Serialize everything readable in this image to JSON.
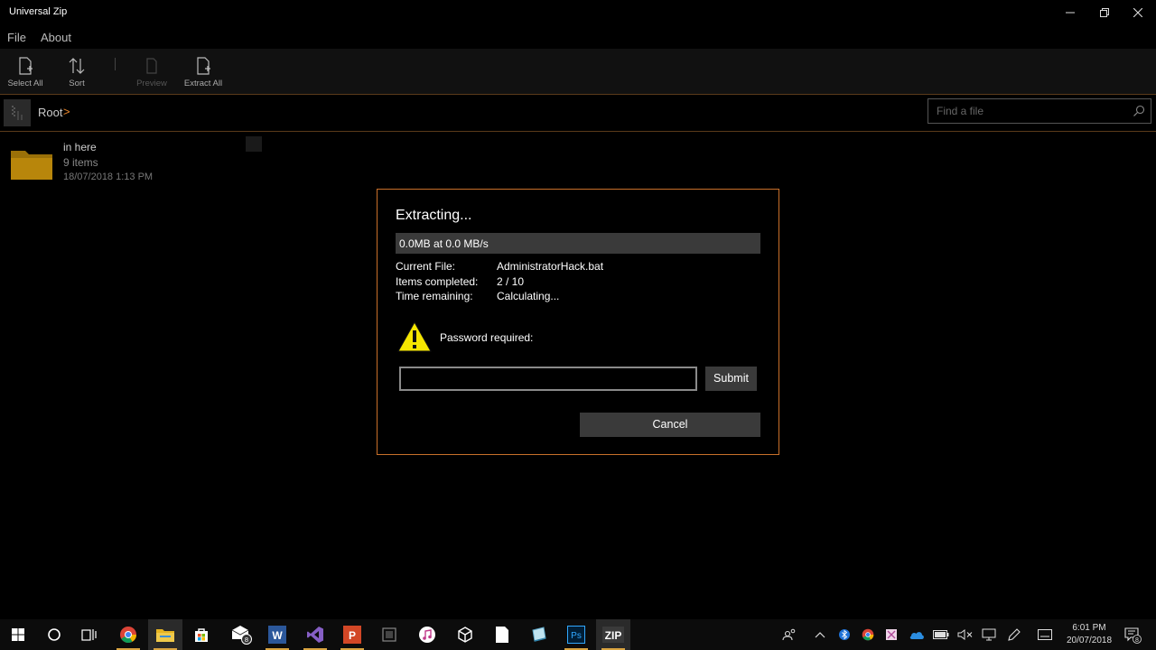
{
  "window": {
    "title": "Universal Zip",
    "minimize": "—",
    "maximize": "▢",
    "close": "✕"
  },
  "menu": {
    "file": "File",
    "about": "About"
  },
  "toolbar": {
    "select_all": "Select All",
    "sort": "Sort",
    "preview": "Preview",
    "extract_all": "Extract All"
  },
  "breadcrumb": {
    "root": "Root",
    "chevron": ">"
  },
  "search": {
    "placeholder": "Find a file"
  },
  "file_item": {
    "name": "in here",
    "count": "9 items",
    "date": "18/07/2018 1:13 PM"
  },
  "dialog": {
    "title": "Extracting...",
    "progress_text": "0.0MB at 0.0 MB/s",
    "progress_fraction": 0,
    "current_file_label": "Current File:",
    "current_file_value": "AdministratorHack.bat",
    "items_completed_label": "Items completed:",
    "items_completed_value": "2 / 10",
    "time_remaining_label": "Time remaining:",
    "time_remaining_value": "Calculating...",
    "password_label": "Password required:",
    "password_value": "",
    "submit_label": "Submit",
    "cancel_label": "Cancel"
  },
  "taskbar": {
    "mail_badge": "8",
    "word_letter": "W",
    "powerpoint_letter": "P",
    "photoshop_letter": "Ps",
    "zip_letter": "ZIP",
    "time": "6:01 PM",
    "date": "20/07/2018",
    "notifications_badge": "8"
  },
  "colors": {
    "accent_border": "#c8702a",
    "folder": "#b8860b",
    "taskbar_running": "#d9a441"
  }
}
